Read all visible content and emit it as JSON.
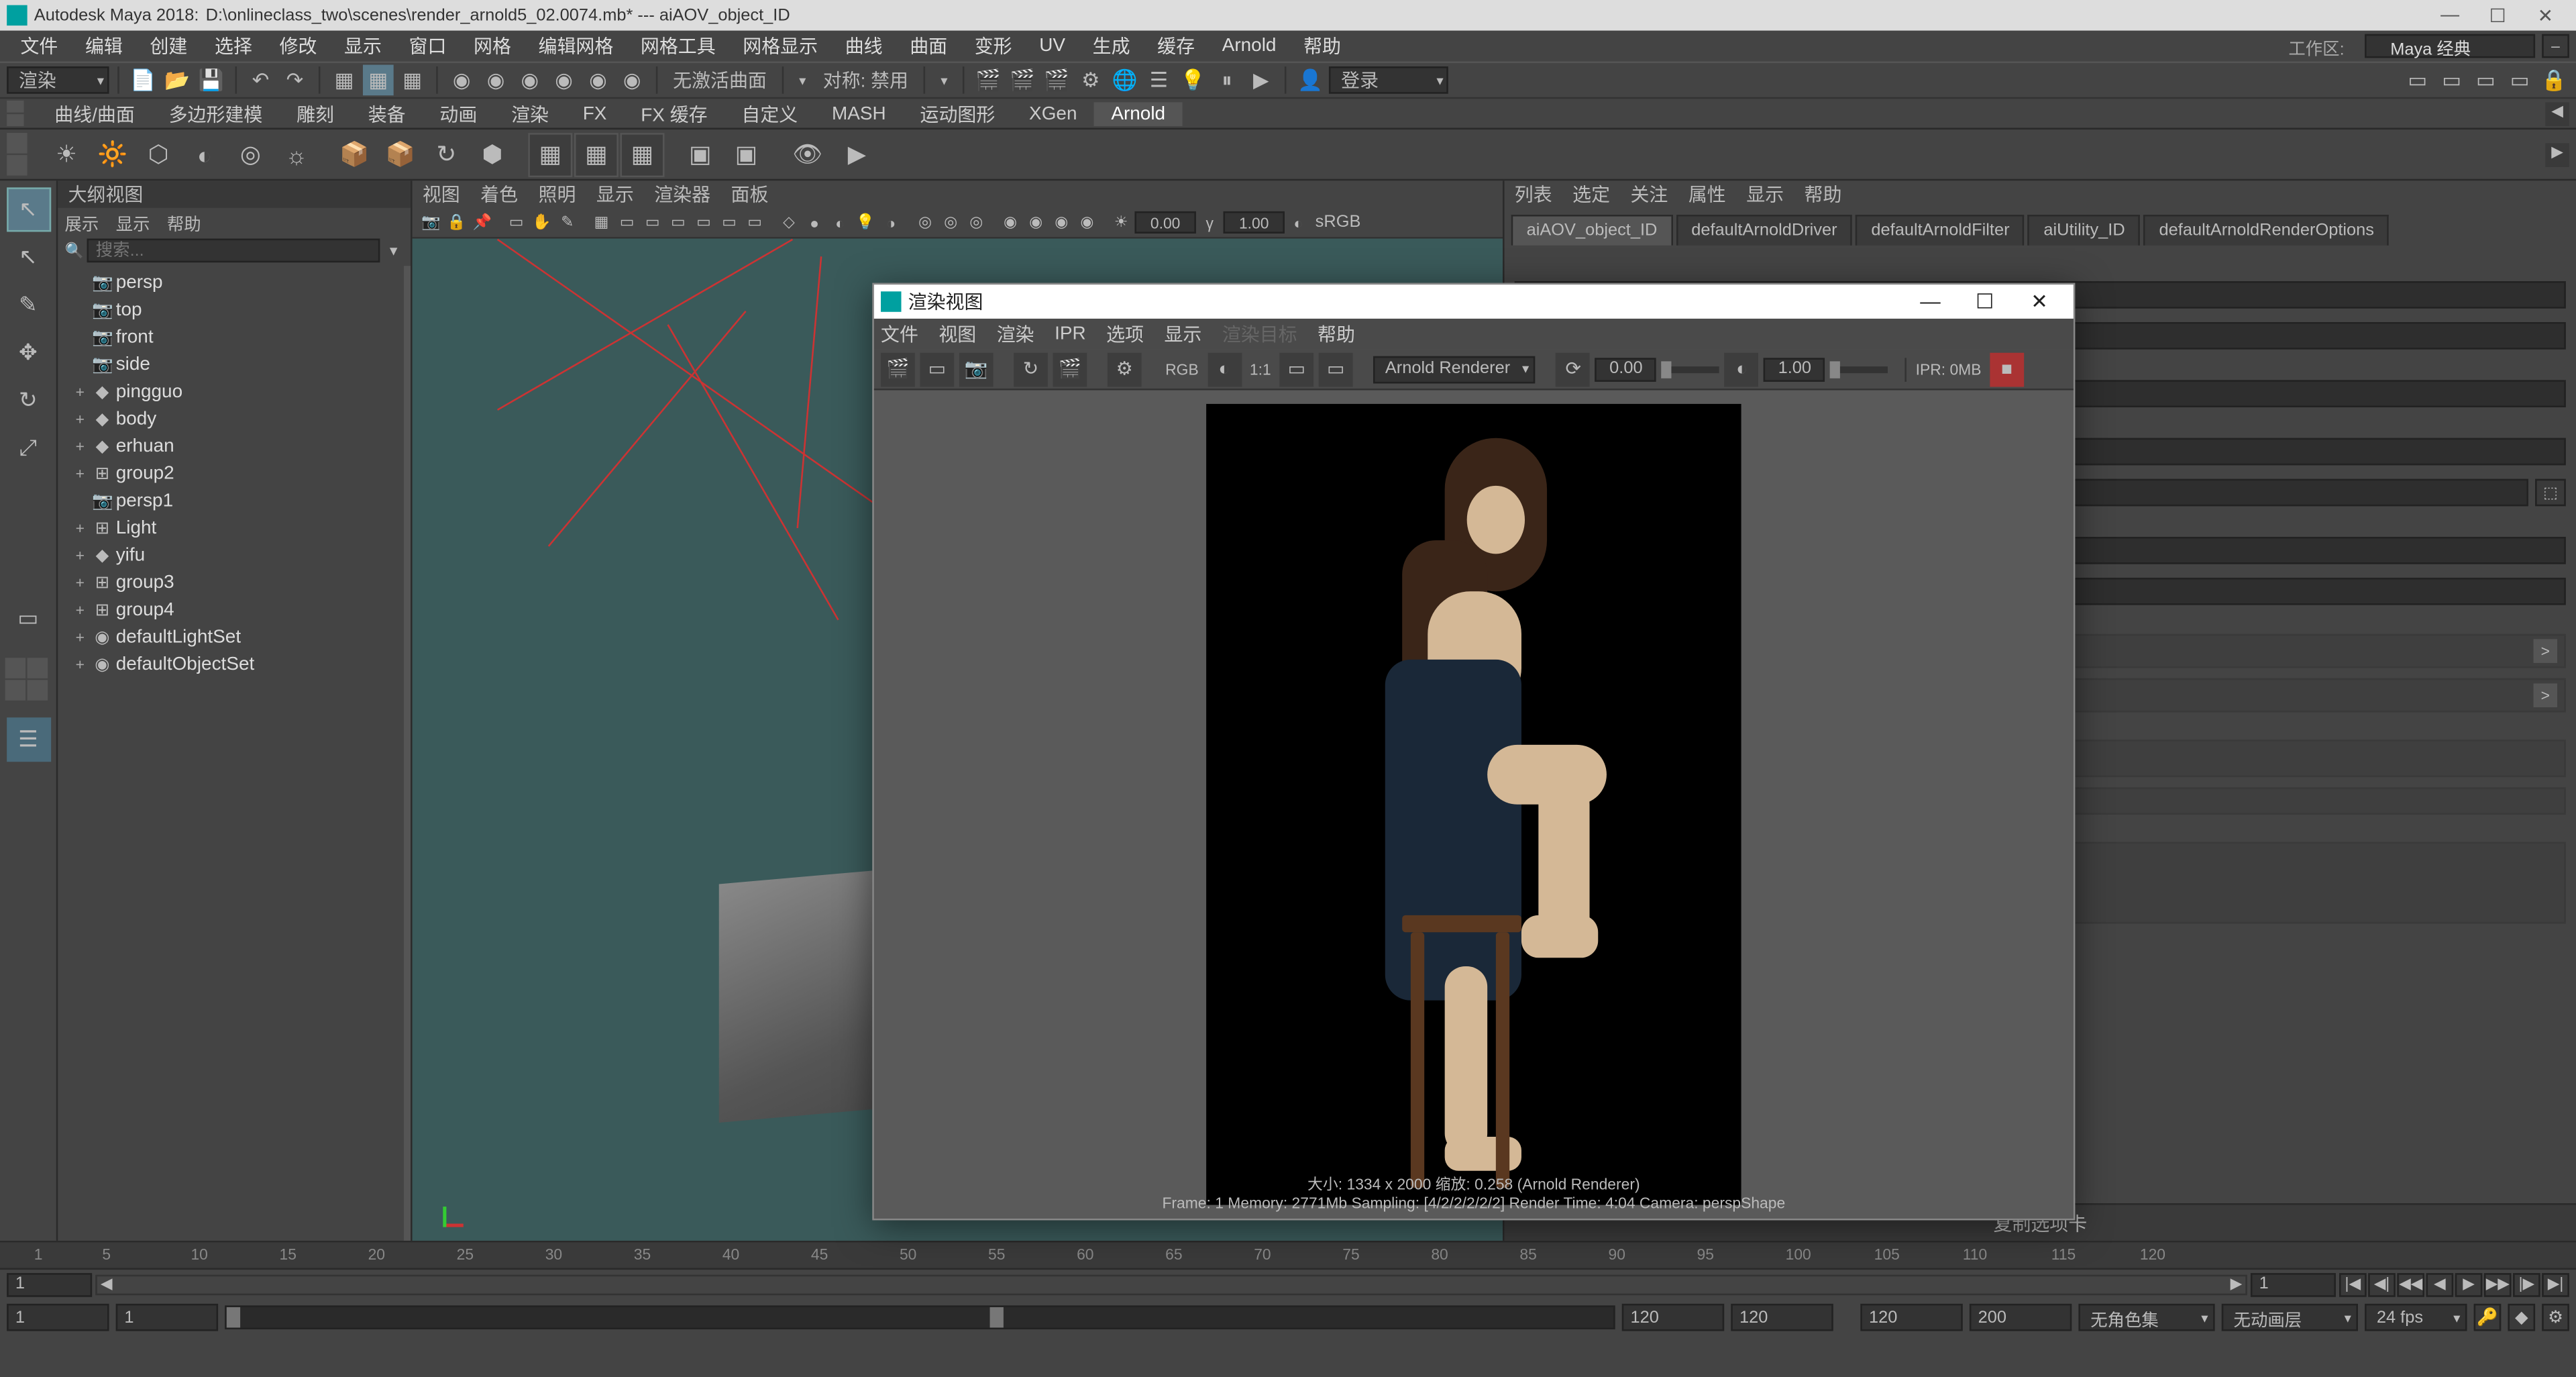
{
  "titlebar": {
    "app": "Autodesk Maya 2018:",
    "file": "D:\\onlineclass_two\\scenes\\render_arnold5_02.0074.mb*  ---  aiAOV_object_ID"
  },
  "menubar": {
    "items": [
      "文件",
      "编辑",
      "创建",
      "选择",
      "修改",
      "显示",
      "窗口",
      "网格",
      "编辑网格",
      "网格工具",
      "网格显示",
      "曲线",
      "曲面",
      "变形",
      "UV",
      "生成",
      "缓存",
      "Arnold",
      "帮助"
    ],
    "workspace_label": "工作区:",
    "workspace_value": "Maya 经典"
  },
  "statusline": {
    "module": "渲染",
    "inactive_text": "无激活曲面",
    "symmetry": "对称: 禁用",
    "login": "登录"
  },
  "shelf": {
    "tabs": [
      "曲线/曲面",
      "多边形建模",
      "雕刻",
      "装备",
      "动画",
      "渲染",
      "FX",
      "FX 缓存",
      "自定义",
      "MASH",
      "运动图形",
      "XGen",
      "Arnold"
    ],
    "active_tab": "Arnold"
  },
  "outliner": {
    "title": "大纲视图",
    "menu": [
      "展示",
      "显示",
      "帮助"
    ],
    "search_placeholder": "搜索...",
    "items": [
      {
        "name": "persp",
        "icon": "cam",
        "level": 0
      },
      {
        "name": "top",
        "icon": "cam",
        "level": 0
      },
      {
        "name": "front",
        "icon": "cam",
        "level": 0
      },
      {
        "name": "side",
        "icon": "cam",
        "level": 0
      },
      {
        "name": "pingguo",
        "icon": "mesh",
        "level": 0,
        "exp": "+"
      },
      {
        "name": "body",
        "icon": "mesh",
        "level": 0,
        "exp": "+"
      },
      {
        "name": "erhuan",
        "icon": "mesh",
        "level": 0,
        "exp": "+"
      },
      {
        "name": "group2",
        "icon": "grp",
        "level": 0,
        "exp": "+"
      },
      {
        "name": "persp1",
        "icon": "cam",
        "level": 0
      },
      {
        "name": "Light",
        "icon": "grp",
        "level": 0,
        "exp": "+"
      },
      {
        "name": "yifu",
        "icon": "mesh",
        "level": 0,
        "exp": "+"
      },
      {
        "name": "group3",
        "icon": "grp",
        "level": 0,
        "exp": "+"
      },
      {
        "name": "group4",
        "icon": "grp",
        "level": 0,
        "exp": "+"
      },
      {
        "name": "defaultLightSet",
        "icon": "set",
        "level": 0,
        "exp": "+"
      },
      {
        "name": "defaultObjectSet",
        "icon": "set",
        "level": 0,
        "exp": "+"
      }
    ]
  },
  "viewport": {
    "menu": [
      "视图",
      "着色",
      "照明",
      "显示",
      "渲染器",
      "面板"
    ],
    "gamma": "0.00",
    "exposure": "1.00",
    "cspace": "sRGB"
  },
  "attr": {
    "menu": [
      "列表",
      "选定",
      "关注",
      "属性",
      "显示",
      "帮助"
    ],
    "tabs": [
      "aiAOV_object_ID",
      "defaultArnoldDriver",
      "defaultArnoldFilter",
      "aiUtility_ID",
      "defaultArnoldRenderOptions"
    ],
    "active_tab": "aiAOV_object_ID",
    "footer": "复制选项卡"
  },
  "render_view": {
    "title": "渲染视图",
    "menu": [
      "文件",
      "视图",
      "渲染",
      "IPR",
      "选项",
      "显示",
      "渲染目标",
      "帮助"
    ],
    "rgb_label": "RGB",
    "ratio": "1:1",
    "renderer": "Arnold Renderer",
    "exp_lo": "0.00",
    "exp_hi": "1.00",
    "ipr_mem": "IPR: 0MB",
    "info_line1": "大小: 1334 x 2000  缩放: 0.258      (Arnold Renderer)",
    "info_line2": "Frame: 1    Memory: 2771Mb    Sampling: [4/2/2/2/2/2]    Render Time: 4:04    Camera: perspShape"
  },
  "timeline": {
    "ticks": [
      "1",
      "5",
      "10",
      "15",
      "20",
      "25",
      "30",
      "35",
      "40",
      "45",
      "50",
      "55",
      "60",
      "65",
      "70",
      "75",
      "80",
      "85",
      "90",
      "95",
      "100",
      "105",
      "110",
      "115",
      "120"
    ],
    "current_frame_left": "1",
    "current_frame_right": "1",
    "range_start": "1",
    "range_start_inner": "1",
    "range_end_inner": "120",
    "range_end": "120",
    "playback_start": "120",
    "playback_end": "200",
    "charset": "无角色集",
    "anim_layer": "无动画层",
    "fps": "24 fps"
  }
}
